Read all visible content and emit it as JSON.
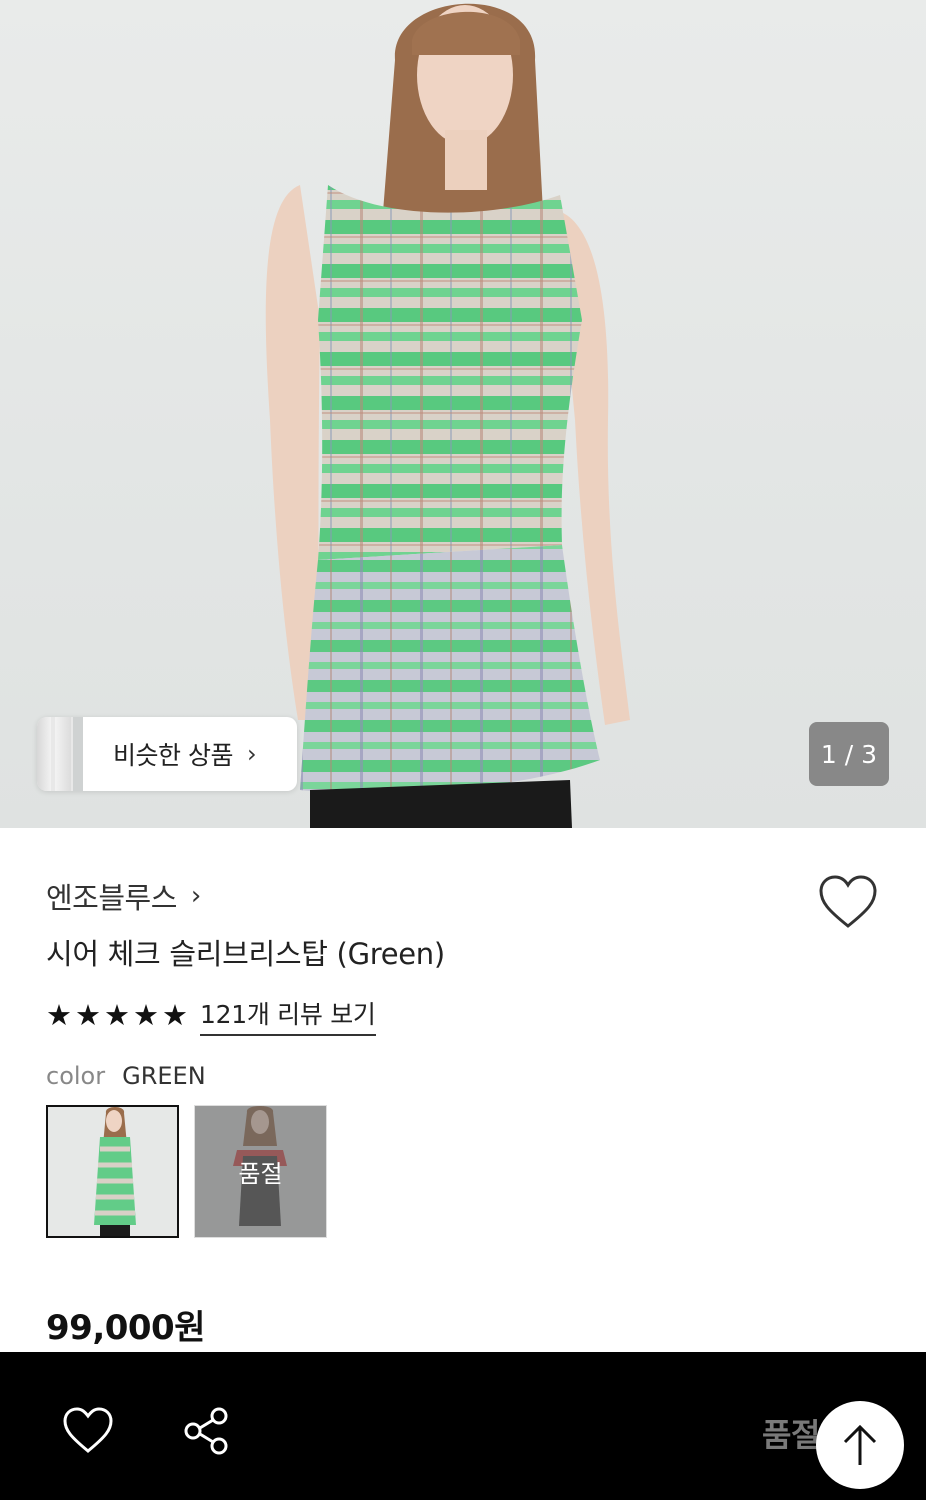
{
  "hero": {
    "similar_label": "비슷한 상품",
    "similar_chevron": "›",
    "page_indicator": "1 / 3"
  },
  "product": {
    "brand": "엔조블루스",
    "brand_chevron": "›",
    "title": "시어 체크 슬리브리스탑 (Green)",
    "stars": [
      "★",
      "★",
      "★",
      "★",
      "★"
    ],
    "review_link": "121개 리뷰 보기",
    "color_label": "color",
    "color_value": "GREEN",
    "swatches": [
      {
        "name": "green",
        "selected": true
      },
      {
        "name": "sold-out-option",
        "badge": "품절"
      }
    ],
    "price": "99,000원"
  },
  "bottom_bar": {
    "soldout_label": "품절"
  },
  "icons": {
    "wishlist": "heart-outline-icon",
    "share": "share-icon",
    "scroll_top": "arrow-up-icon",
    "star": "star-icon"
  },
  "colors": {
    "check_green": "#4ec97a",
    "bottom_bar": "#000000"
  }
}
